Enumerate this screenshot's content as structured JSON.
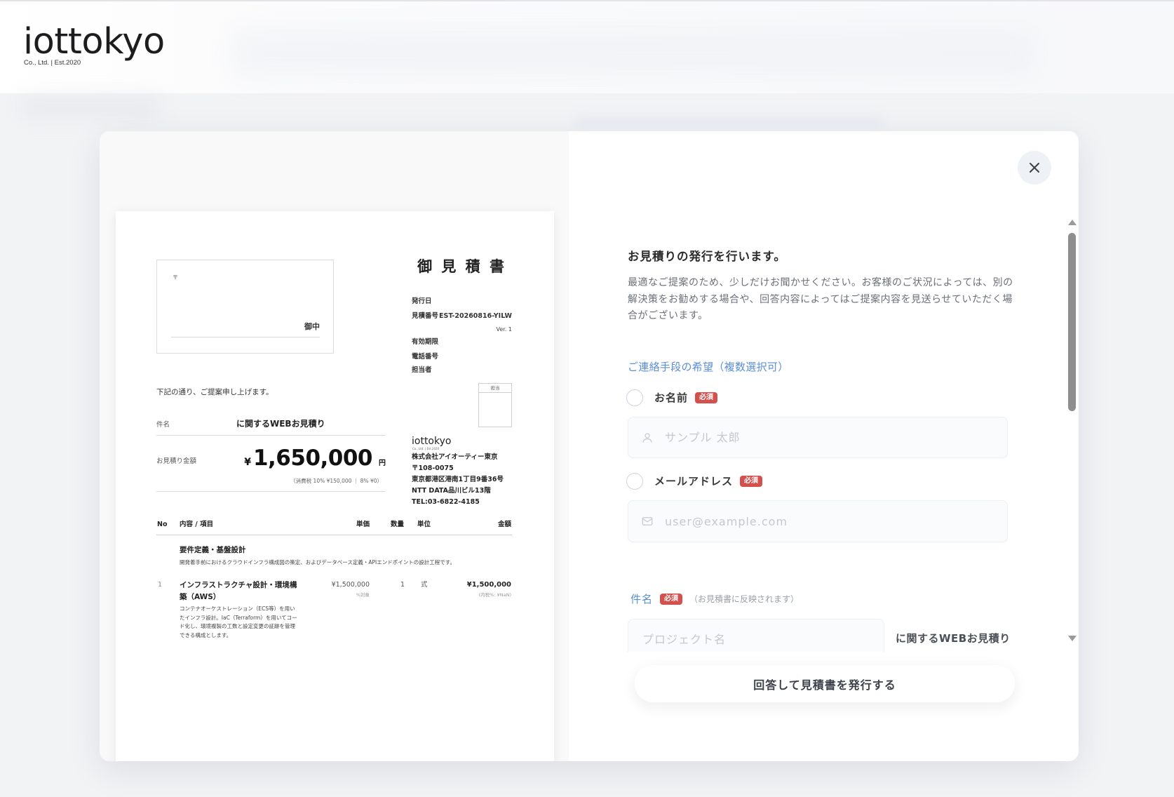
{
  "theme": {
    "accent": "#5a8ed6",
    "required": "#d4504c",
    "text": "#333333"
  },
  "brand": {
    "name": "iottokyo",
    "tagline": "Co., Ltd. | Est.2020"
  },
  "close_icon": "close-icon",
  "quote": {
    "title": "御 見 積 書",
    "recipient": {
      "postal_mark": "〒",
      "honorific": "御中"
    },
    "meta": [
      {
        "label": "発行日"
      },
      {
        "label": "見積番号",
        "value": "EST-20260816-YILW",
        "version": "Ver. 1"
      },
      {
        "label": "有効期限"
      },
      {
        "label": "電話番号"
      },
      {
        "label": "担当者"
      }
    ],
    "stamp_label": "担当",
    "intro": "下記の通り、ご提案申し上げます。",
    "subject_label": "件名",
    "subject": "に関するWEBお見積り",
    "amount_label": "お見積り金額",
    "currency_symbol": "¥",
    "amount": "1,650,000",
    "amount_unit": "円",
    "tax_note": "（消費税 10% ¥150,000 ｜ 8% ¥0）",
    "issuer": {
      "logo": "iottokyo",
      "logo_tagline": "Co., Ltd. | Est.2020",
      "lines": [
        "株式会社アイオーティー東京",
        "〒108-0075",
        "東京都港区港南1丁目9番36号",
        "NTT DATA品川ビル13階",
        "TEL:03-6822-4185"
      ]
    },
    "table": {
      "headers": {
        "no": "No",
        "item": "内容 / 項目",
        "unit_price": "単価",
        "qty": "数量",
        "unit": "単位",
        "amount": "金額"
      },
      "section": {
        "title": "要件定義・基盤設計",
        "description": "開発着手前におけるクラウドインフラ構成図の策定、およびデータベース定義・APIエンドポイントの設計工程です。"
      },
      "rows": [
        {
          "no": "1",
          "name": "インフラストラクチャ設計・環境構築（AWS）",
          "unit_price": "¥1,500,000",
          "tax_type": "%対象",
          "qty": "1",
          "unit": "式",
          "amount": "¥1,500,000",
          "tax_note": "(内税%: ¥NaN)",
          "description": "コンテナオーケストレーション（ECS等）を用いたインフラ設計。IaC（Terraform）を用いてコード化し、環境複製の工数と設定変更の証跡を管理できる構成とします。"
        }
      ]
    }
  },
  "form": {
    "heading": "お見積りの発行を行います。",
    "lead": "最適なご提案のため、少しだけお聞かせください。お客様のご状況によっては、別の解決策をお勧めする場合や、回答内容によってはご提案内容を見送らせていただく場合がございます。",
    "contact_label": "ご連絡手段の希望（複数選択可）",
    "contact_options": [
      {
        "label": "お名前",
        "badge": "必須",
        "checked": false,
        "icon": "user-icon",
        "placeholder": "サンプル 太郎"
      },
      {
        "label": "メールアドレス",
        "badge": "必須",
        "checked": false,
        "icon": "mail-icon",
        "placeholder": "user@example.com"
      }
    ],
    "subject": {
      "label": "件名",
      "badge": "必須",
      "note": "（お見積書に反映されます）",
      "placeholder": "プロジェクト名",
      "suffix": "に関するWEBお見積り"
    },
    "submit_label": "回答して見積書を発行する"
  }
}
